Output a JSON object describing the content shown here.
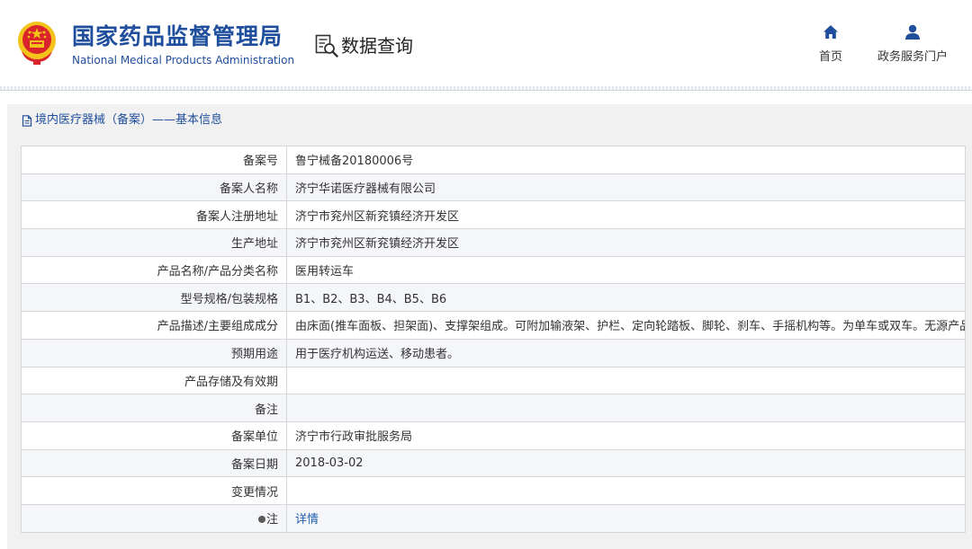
{
  "site": {
    "title_cn": "国家药品监督管理局",
    "title_en": "National Medical Products Administration",
    "section": "数据查询",
    "nav": {
      "home": "首页",
      "portal": "政务服务门户"
    }
  },
  "panel": {
    "title": "境内医疗器械（备案）——基本信息",
    "rows": [
      {
        "label": "备案号",
        "value": "鲁宁械备20180006号"
      },
      {
        "label": "备案人名称",
        "value": "济宁华诺医疗器械有限公司"
      },
      {
        "label": "备案人注册地址",
        "value": "济宁市兖州区新兖镇经济开发区"
      },
      {
        "label": "生产地址",
        "value": "济宁市兖州区新兖镇经济开发区"
      },
      {
        "label": "产品名称/产品分类名称",
        "value": "医用转运车"
      },
      {
        "label": "型号规格/包装规格",
        "value": "B1、B2、B3、B4、B5、B6"
      },
      {
        "label": "产品描述/主要组成成分",
        "value": "由床面(推车面板、担架面)、支撑架组成。可附加输液架、护栏、定向轮踏板、脚轮、刹车、手摇机构等。为单车或双车。无源产品"
      },
      {
        "label": "预期用途",
        "value": "用于医疗机构运送、移动患者。"
      },
      {
        "label": "产品存储及有效期",
        "value": ""
      },
      {
        "label": "备注",
        "value": ""
      },
      {
        "label": "备案单位",
        "value": "济宁市行政审批服务局"
      },
      {
        "label": "备案日期",
        "value": "2018-03-02"
      },
      {
        "label": "变更情况",
        "value": ""
      },
      {
        "label": "注",
        "value": "详情"
      }
    ]
  },
  "colors": {
    "brand": "#1f4e9c",
    "link": "#1f5fae",
    "emblem_red": "#d8242a",
    "emblem_gold": "#f3c21b"
  },
  "icons": [
    "national-emblem-icon",
    "data-query-icon",
    "home-icon",
    "user-icon",
    "document-icon",
    "bulb-icon"
  ]
}
